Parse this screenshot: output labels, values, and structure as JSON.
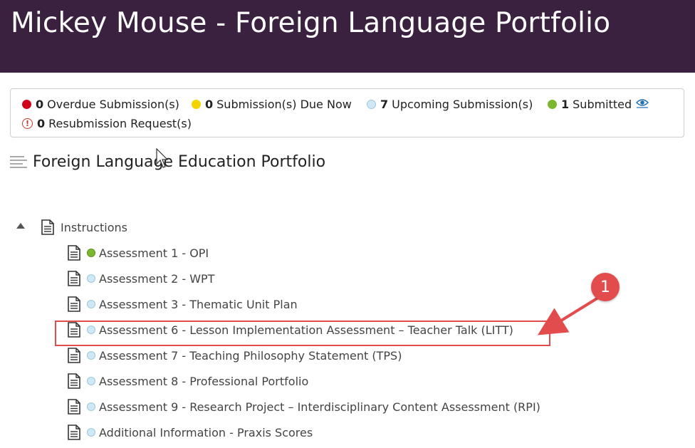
{
  "header": {
    "title": "Mickey Mouse - Foreign Language Portfolio"
  },
  "status": {
    "overdue": {
      "count": "0",
      "label": "Overdue Submission(s)",
      "color": "#d0021b"
    },
    "due_now": {
      "count": "0",
      "label": "Submission(s) Due Now",
      "color": "#f5d300"
    },
    "upcoming": {
      "count": "7",
      "label": "Upcoming Submission(s)",
      "color": "#cfe8f6"
    },
    "submitted": {
      "count": "1",
      "label": "Submitted",
      "color": "#7cb82f"
    },
    "resubmission": {
      "count": "0",
      "label": "Resubmission Request(s)",
      "color": "#c0392b"
    }
  },
  "section": {
    "title": "Foreign Language Education Portfolio"
  },
  "tree": {
    "root": {
      "label": "Instructions"
    },
    "items": [
      {
        "label": "Assessment 1 - OPI",
        "status": "submitted"
      },
      {
        "label": "Assessment 2 - WPT",
        "status": "upcoming"
      },
      {
        "label": "Assessment 3 - Thematic Unit Plan",
        "status": "upcoming"
      },
      {
        "label": "Assessment 6 - Lesson Implementation Assessment – Teacher Talk (LITT)",
        "status": "upcoming"
      },
      {
        "label": "Assessment 7 - Teaching Philosophy Statement (TPS)",
        "status": "upcoming"
      },
      {
        "label": "Assessment 8 - Professional Portfolio",
        "status": "upcoming"
      },
      {
        "label": "Assessment 9 - Research Project – Interdisciplinary Content Assessment (RPI)",
        "status": "upcoming"
      },
      {
        "label": "Additional Information - Praxis Scores",
        "status": "upcoming"
      }
    ]
  },
  "annotation": {
    "number": "1",
    "color": "#e34c4c"
  }
}
